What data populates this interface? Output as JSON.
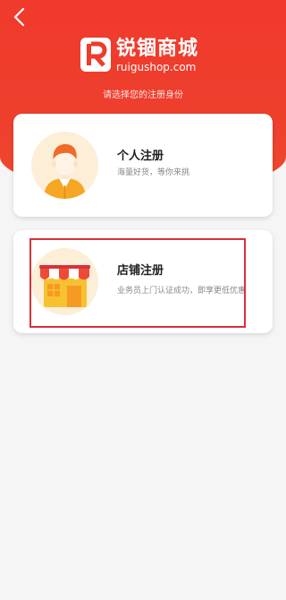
{
  "header": {
    "back_icon": "chevron-left-icon",
    "logo_cn": "锐锢商城",
    "logo_en": "ruigushop.com",
    "subtitle": "请选择您的注册身份"
  },
  "cards": {
    "personal": {
      "title": "个人注册",
      "desc": "海量好货，等你来挑",
      "icon": "person-avatar-icon"
    },
    "store": {
      "title": "店铺注册",
      "desc": "业务员上门认证成功，即享更低优惠",
      "icon": "storefront-icon"
    }
  },
  "colors": {
    "brand_red": "#f03a2c",
    "highlight": "#d9303d",
    "avatar_bg": "#fdeed7"
  }
}
